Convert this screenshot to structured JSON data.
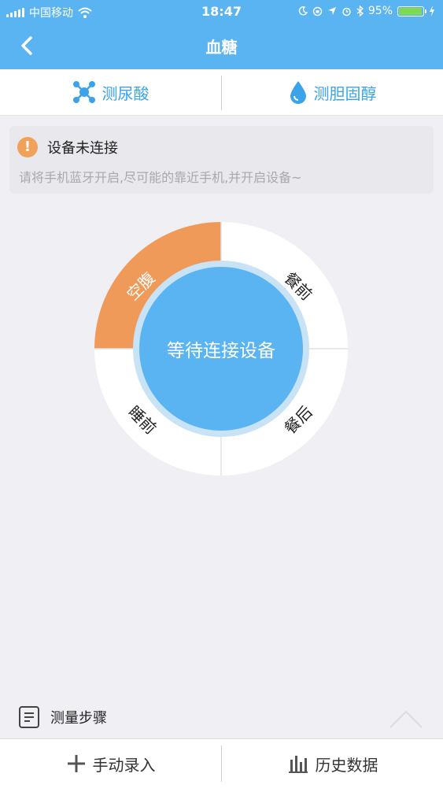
{
  "status_bar": {
    "carrier": "中国移动",
    "time": "18:47",
    "battery": "95%",
    "battery_level": 0.95,
    "icons": [
      "signal-icon",
      "wifi-icon",
      "moon-icon",
      "orientation-lock-icon",
      "location-icon",
      "alarm-icon",
      "bluetooth-icon",
      "battery-icon",
      "charging-icon"
    ]
  },
  "header": {
    "title": "血糖",
    "back_icon": "chevron-left-icon"
  },
  "tabs": [
    {
      "label": "测尿酸",
      "icon": "molecule-icon"
    },
    {
      "label": "测胆固醇",
      "icon": "water-drop-icon"
    }
  ],
  "notice": {
    "icon": "warning-icon",
    "icon_text": "!",
    "title": "设备未连接",
    "description": "请将手机蓝牙开启,尽可能的靠近手机,并开启设备~"
  },
  "dial": {
    "center_text": "等待连接设备",
    "segments": [
      {
        "label": "空腹",
        "active": true
      },
      {
        "label": "餐前",
        "active": false
      },
      {
        "label": "餐后",
        "active": false
      },
      {
        "label": "睡前",
        "active": false
      }
    ],
    "colors": {
      "active": "#f09a5a",
      "center": "#5ab4f2",
      "ring": "#c9e3f6",
      "inactive": "#ffffff"
    }
  },
  "steps": {
    "label": "测量步骤",
    "icon": "document-icon"
  },
  "bottom_bar": {
    "manual_entry": "手动录入",
    "history": "历史数据",
    "manual_icon": "plus-icon",
    "history_icon": "bar-chart-icon"
  },
  "colors": {
    "header": "#5ab4f2",
    "accent": "#3aa3ea",
    "background": "#f0eff4"
  }
}
